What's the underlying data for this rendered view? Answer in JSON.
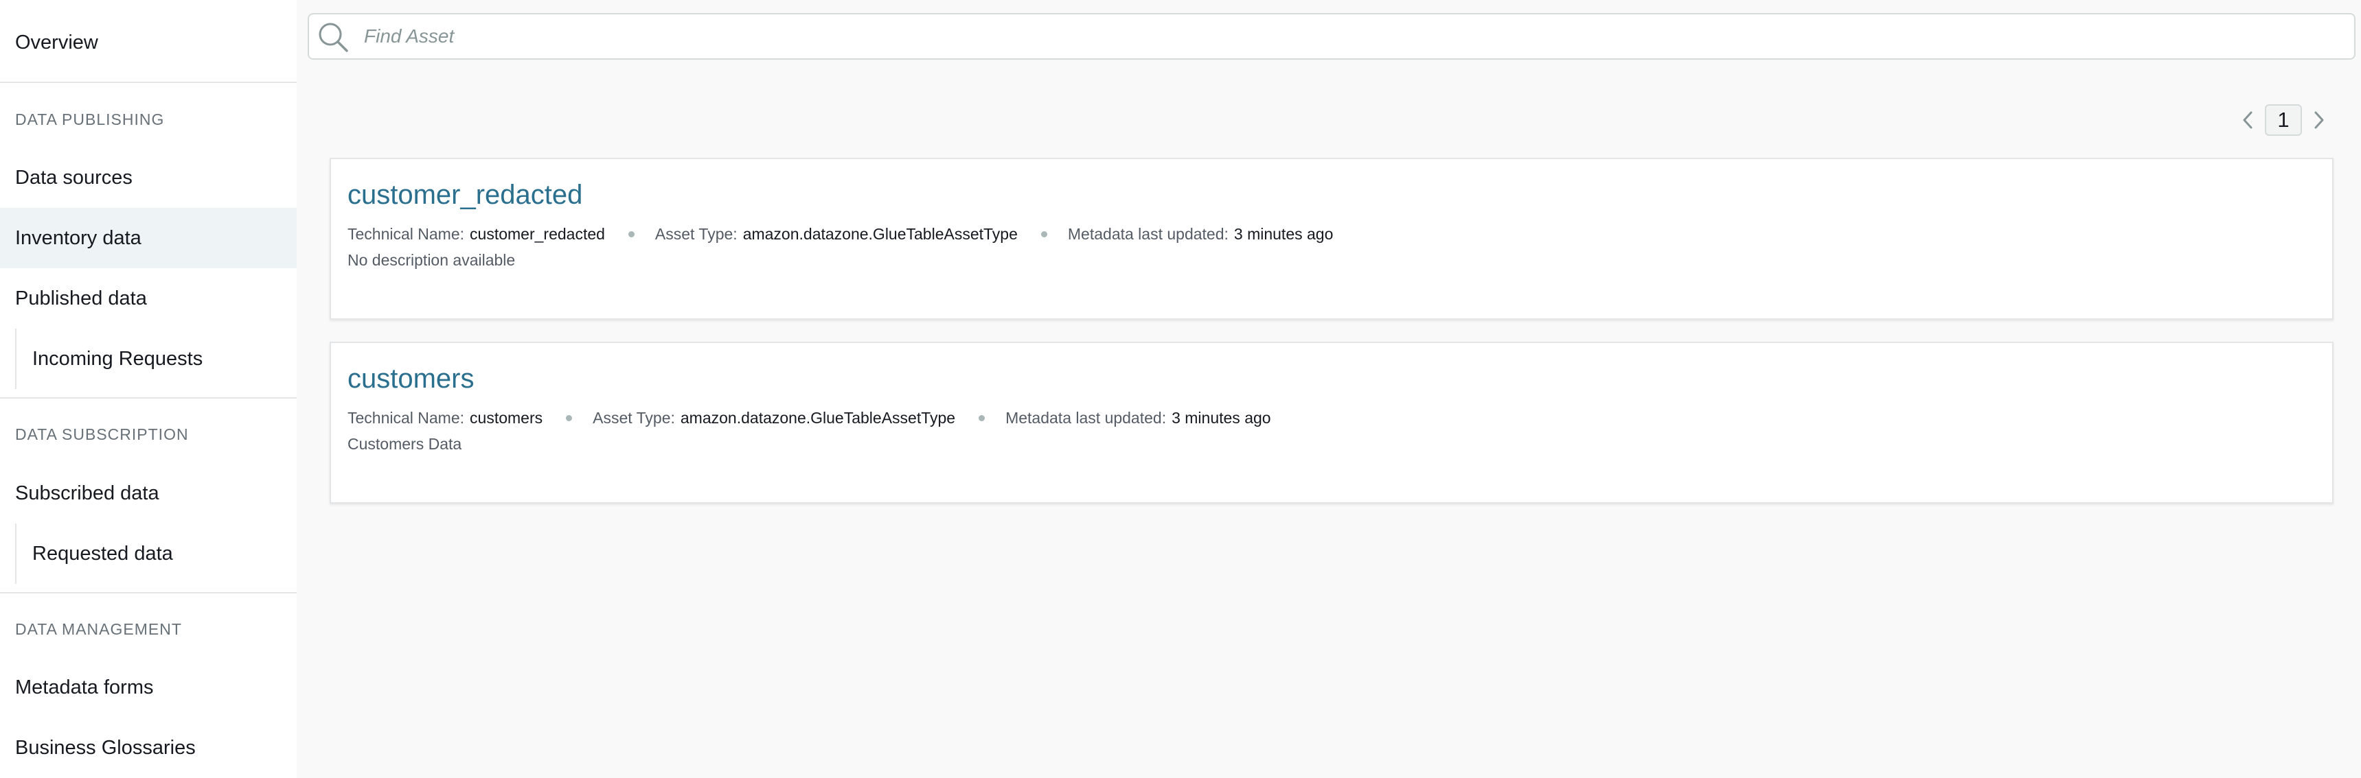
{
  "sidebar": {
    "overview": "Overview",
    "sections": [
      {
        "label": "DATA PUBLISHING"
      },
      {
        "label": "DATA SUBSCRIPTION"
      },
      {
        "label": "DATA MANAGEMENT"
      }
    ],
    "items": [
      {
        "label": "Data sources"
      },
      {
        "label": "Inventory data",
        "active": true
      },
      {
        "label": "Published data"
      },
      {
        "label": "Incoming Requests"
      },
      {
        "label": "Subscribed data"
      },
      {
        "label": "Requested data"
      },
      {
        "label": "Metadata forms"
      },
      {
        "label": "Business Glossaries"
      }
    ]
  },
  "search": {
    "placeholder": "Find Asset",
    "value": ""
  },
  "pagination": {
    "current_page": "1"
  },
  "assets": [
    {
      "title": "customer_redacted",
      "technical_name_label": "Technical Name:",
      "technical_name": "customer_redacted",
      "asset_type_label": "Asset Type:",
      "asset_type": "amazon.datazone.GlueTableAssetType",
      "updated_label": "Metadata last updated:",
      "updated": "3 minutes ago",
      "description": "No description available"
    },
    {
      "title": "customers",
      "technical_name_label": "Technical Name:",
      "technical_name": "customers",
      "asset_type_label": "Asset Type:",
      "asset_type": "amazon.datazone.GlueTableAssetType",
      "updated_label": "Metadata last updated:",
      "updated": "3 minutes ago",
      "description": "Customers Data"
    }
  ],
  "icons": {
    "search": "search-icon",
    "prev": "chevron-left-icon",
    "next": "chevron-right-icon"
  },
  "colors": {
    "link": "#2b6f8e",
    "active_nav_bg": "#eef3f5",
    "page_bg": "#f9f9f9"
  }
}
